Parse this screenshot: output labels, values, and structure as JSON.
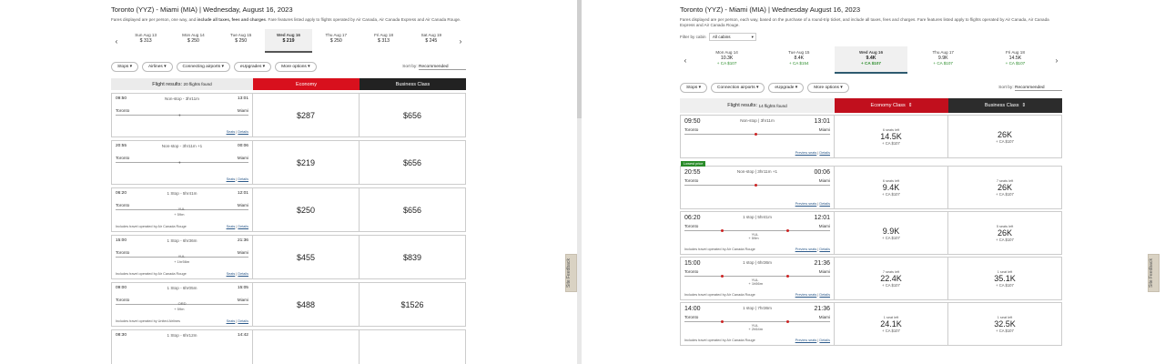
{
  "left": {
    "title": "Toronto (YYZ) - Miami (MIA) | Wednesday, August 16, 2023",
    "fares_note_a": "Fares displayed are per person, one way, and",
    "fares_note_b": "include all taxes, fees and charges",
    "fares_note_c": ". Fare features listed apply to flights operated by Air Canada, Air Canada Express and Air Canada Rouge.",
    "dates": [
      {
        "d": "Sun Aug 13",
        "p": "$ 313"
      },
      {
        "d": "Mon Aug 14",
        "p": "$ 250"
      },
      {
        "d": "Tue Aug 15",
        "p": "$ 250"
      },
      {
        "d": "Wed Aug 16",
        "p": "$ 219",
        "active": true
      },
      {
        "d": "Thu Aug 17",
        "p": "$ 250"
      },
      {
        "d": "Fri Aug 18",
        "p": "$ 313"
      },
      {
        "d": "Sat Aug 19",
        "p": "$ 245"
      }
    ],
    "filters": [
      "Stops",
      "Airlines",
      "Connecting airports",
      "eUpgrades",
      "More options"
    ],
    "sort_label": "Sort by:",
    "sort_value": "Recommended",
    "results_label": "Flight results:",
    "results_count": "20 flights found",
    "economy": "Economy",
    "business": "Business Class",
    "seats": "Seats",
    "details": "Details",
    "flights": [
      {
        "dep": "09:50",
        "arr": "13:01",
        "dur": "Non-stop - 3hr11m",
        "from": "Toronto",
        "to": "Miami",
        "eco": "$287",
        "bus": "$656",
        "ops": ""
      },
      {
        "dep": "20:55",
        "arr": "00:06",
        "dur": "Non-stop - 3hr11m +1",
        "from": "Toronto",
        "to": "Miami",
        "eco": "$219",
        "bus": "$656",
        "ops": ""
      },
      {
        "dep": "06:20",
        "arr": "12:01",
        "dur": "1 Stop - 5hr41m",
        "from": "Toronto",
        "to": "Miami",
        "stop": "YUL",
        "lay": "+ 59m",
        "eco": "$250",
        "bus": "$656",
        "ops": "Includes travel operated by Air Canada Rouge"
      },
      {
        "dep": "15:00",
        "arr": "21:36",
        "dur": "1 Stop - 6hr36m",
        "from": "Toronto",
        "to": "Miami",
        "stop": "YUL",
        "lay": "+ 1hr56m",
        "eco": "$455",
        "bus": "$839",
        "ops": "Includes travel operated by Air Canada Rouge"
      },
      {
        "dep": "09:00",
        "arr": "15:05",
        "dur": "1 Stop - 6hr05m",
        "from": "Toronto",
        "to": "Miami",
        "stop": "ORD",
        "lay": "+ 59m",
        "eco": "$488",
        "bus": "$1526",
        "ops": "Includes travel operated by United Airlines"
      },
      {
        "dep": "08:30",
        "arr": "14:42",
        "dur": "1 Stop - 6hr12m",
        "from": "",
        "to": "",
        "eco": "",
        "bus": "",
        "ops": ""
      }
    ],
    "feedback": "Site Feedback"
  },
  "right": {
    "title": "Toronto (YYZ) - Miami (MIA) | Wednesday August 16, 2023",
    "fares_note": "Fares displayed are per person, each way, based on the purchase of a round-trip ticket, and include all taxes, fees and charges. Fare features listed apply to flights operated by Air Canada, Air Canada Express and Air Canada Rouge.",
    "cabin_label": "Filter by cabin",
    "cabin_value": "All cabins",
    "dates": [
      {
        "d": "Mon Aug 14",
        "p": "10.3K",
        "p2": "+ CA $107"
      },
      {
        "d": "Tue Aug 15",
        "p": "8.4K",
        "p2": "+ CA $154"
      },
      {
        "d": "Wed Aug 16",
        "p": "9.4K",
        "p2": "+ CA $107",
        "active": true
      },
      {
        "d": "Thu Aug 17",
        "p": "9.9K",
        "p2": "+ CA $107"
      },
      {
        "d": "Fri Aug 18",
        "p": "14.5K",
        "p2": "+ CA $107"
      }
    ],
    "filters": [
      "Stops",
      "Connection airports",
      "eUpgrade",
      "More options"
    ],
    "sort_label": "Sort by:",
    "sort_value": "Recommended",
    "results_label": "Flight results:",
    "results_count": "14 flights found",
    "economy": "Economy Class",
    "business": "Business Class",
    "preview": "Preview seats",
    "details": "Details",
    "lowest": "Lowest price",
    "flights": [
      {
        "dep": "09:50",
        "arr": "13:01",
        "dur": "Non-stop | 3hr11m",
        "from": "Toronto",
        "to": "Miami",
        "eseats": "6 seats left",
        "eco": "14.5K",
        "ecof": "+ CA $107",
        "bseats": "",
        "bus": "26K",
        "busf": "+ CA $107",
        "ops": ""
      },
      {
        "dep": "20:55",
        "arr": "00:06",
        "dur": "Non-stop | 3hr11m +1",
        "from": "Toronto",
        "to": "Miami",
        "eseats": "6 seats left",
        "eco": "9.4K",
        "ecof": "+ CA $107",
        "bseats": "7 seats left",
        "bus": "26K",
        "busf": "+ CA $107",
        "ops": "",
        "lowest": true
      },
      {
        "dep": "06:20",
        "arr": "12:01",
        "dur": "1 stop | 5hr41m",
        "from": "Toronto",
        "to": "Miami",
        "stop": "YUL",
        "lay": "+ 59m",
        "eseats": "",
        "eco": "9.9K",
        "ecof": "+ CA $107",
        "bseats": "5 seats left",
        "bus": "26K",
        "busf": "+ CA $107",
        "ops": "Includes travel operated by Air Canada Rouge"
      },
      {
        "dep": "15:00",
        "arr": "21:36",
        "dur": "1 stop | 6hr36m",
        "from": "Toronto",
        "to": "Miami",
        "stop": "YUL",
        "lay": "+ 1h56m",
        "eseats": "7 seats left",
        "eco": "22.4K",
        "ecof": "+ CA $107",
        "bseats": "1 seat left",
        "bus": "35.1K",
        "busf": "+ CA $107",
        "ops": "Includes travel operated by Air Canada Rouge"
      },
      {
        "dep": "14:00",
        "arr": "21:36",
        "dur": "1 stop | 7hr36m",
        "from": "Toronto",
        "to": "Miami",
        "stop": "YUL",
        "lay": "+ 2h54m",
        "eseats": "1 seat left",
        "eco": "24.1K",
        "ecof": "+ CA $107",
        "bseats": "1 seat left",
        "bus": "32.5K",
        "busf": "+ CA $107",
        "ops": "Includes travel operated by Air Canada Rouge"
      }
    ],
    "feedback": "Site Feedback"
  }
}
